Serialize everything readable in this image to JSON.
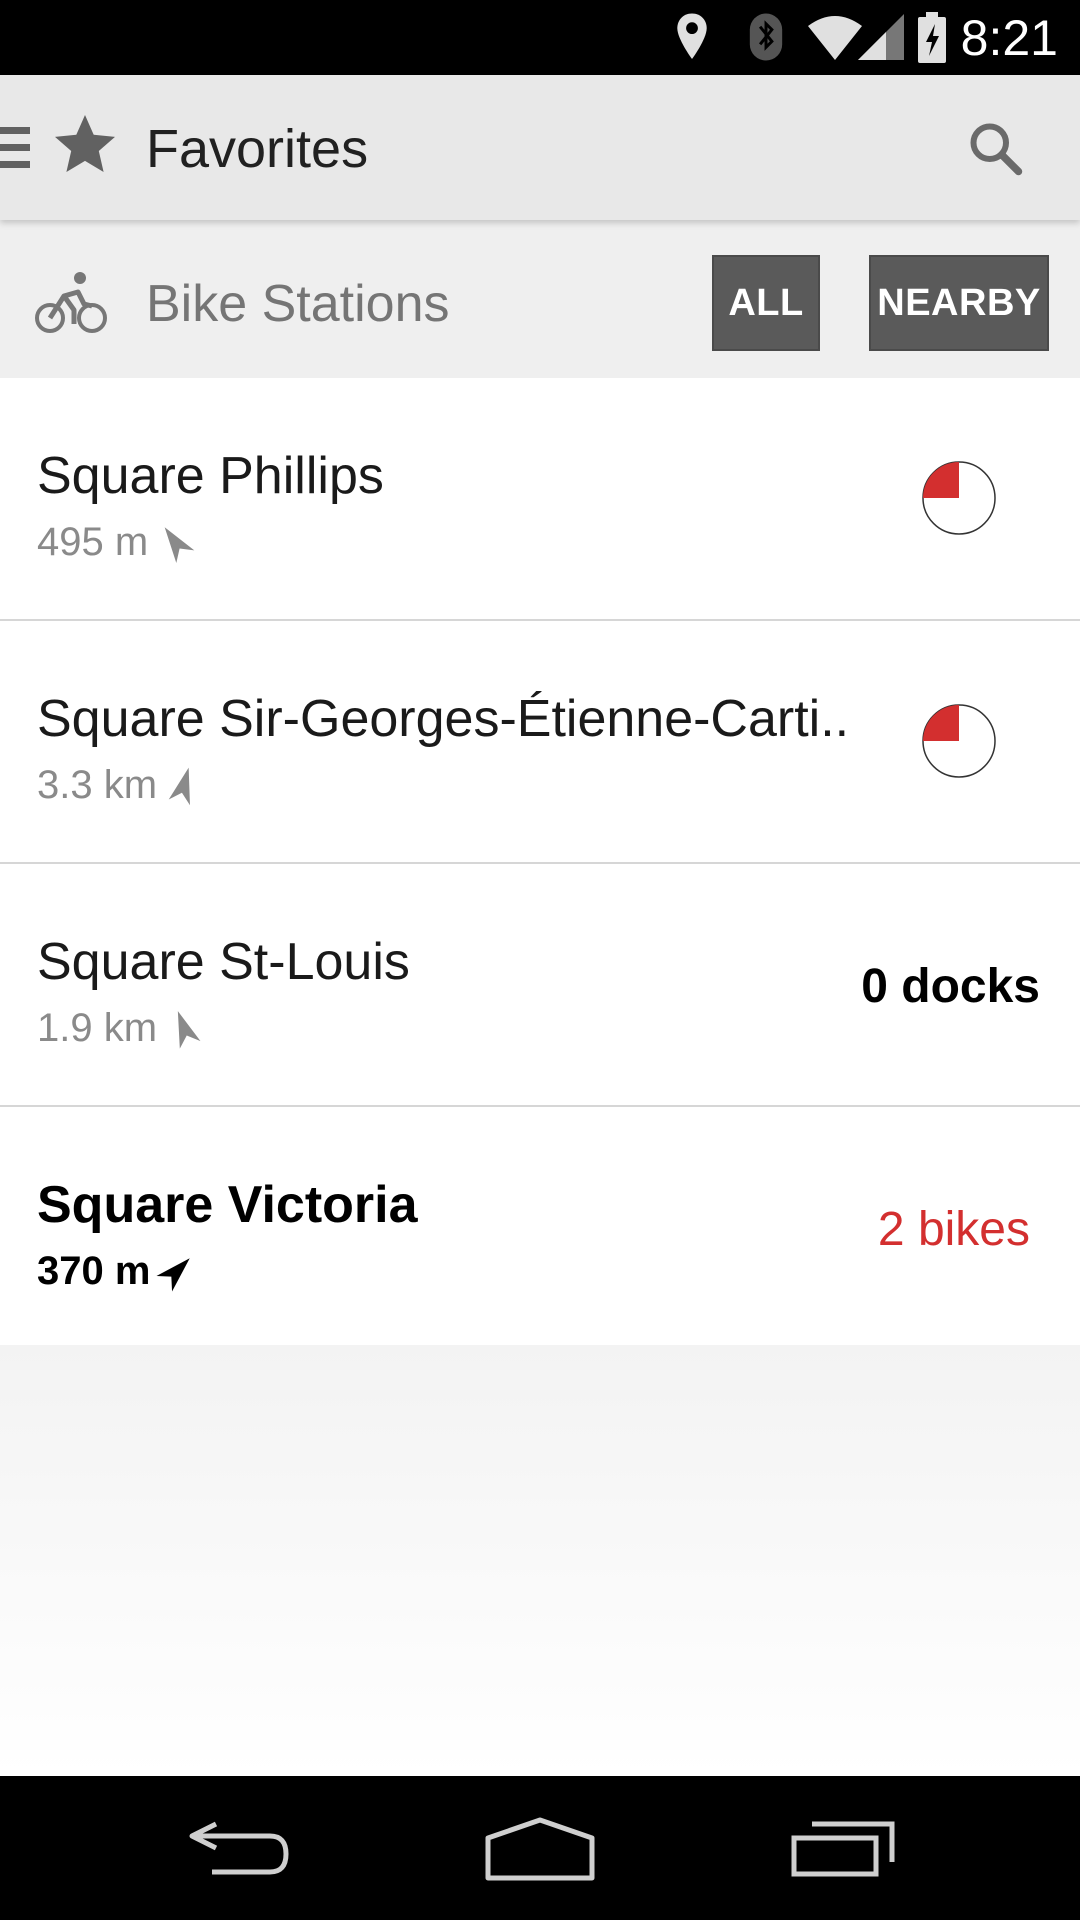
{
  "status_bar": {
    "time": "8:21",
    "icons": [
      "location-icon",
      "bluetooth-icon",
      "wifi-icon",
      "signal-icon",
      "battery-charging-icon"
    ]
  },
  "app_bar": {
    "title": "Favorites",
    "menu_icon": "menu-icon",
    "title_icon": "star-icon",
    "search_icon": "search-icon"
  },
  "section": {
    "label": "Bike Stations",
    "icon": "bike-icon",
    "filter_all": "ALL",
    "filter_nearby": "NEARBY"
  },
  "stations": [
    {
      "name": "Square Phillips",
      "distance": "495 m",
      "status_type": "pie",
      "fill_fraction": 0.25
    },
    {
      "name": "Square Sir-Georges-Étienne-Carti..",
      "distance": "3.3 km",
      "status_type": "pie",
      "fill_fraction": 0.25
    },
    {
      "name": "Square St-Louis",
      "distance": "1.9 km",
      "status_type": "text",
      "value": "0 docks",
      "value_color": "#000000"
    },
    {
      "name": "Square Victoria",
      "distance": "370 m",
      "status_type": "text",
      "value": "2 bikes",
      "value_color": "#d32f2f",
      "highlighted": true
    }
  ],
  "colors": {
    "accent_red": "#d32f2f",
    "button_bg": "#5a5a5a"
  },
  "nav_bar": {
    "back_icon": "back-icon",
    "home_icon": "home-icon",
    "recents_icon": "recents-icon"
  }
}
